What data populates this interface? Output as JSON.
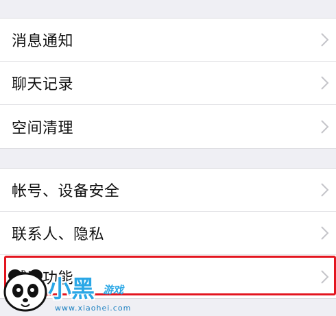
{
  "settings": {
    "group1": [
      {
        "label": "消息通知"
      },
      {
        "label": "聊天记录"
      },
      {
        "label": "空间清理"
      }
    ],
    "group2": [
      {
        "label": "帐号、设备安全"
      },
      {
        "label": "联系人、隐私"
      },
      {
        "label": "辅助功能"
      }
    ]
  },
  "highlight": {
    "color": "#e3151f",
    "target": "辅助功能"
  },
  "watermark": {
    "logo_text": "小黑",
    "sub_text": "游戏",
    "url": "www.xiaohei.com"
  },
  "icons": {
    "row_arrow": "chevron-right-icon",
    "mascot": "panda-icon"
  }
}
